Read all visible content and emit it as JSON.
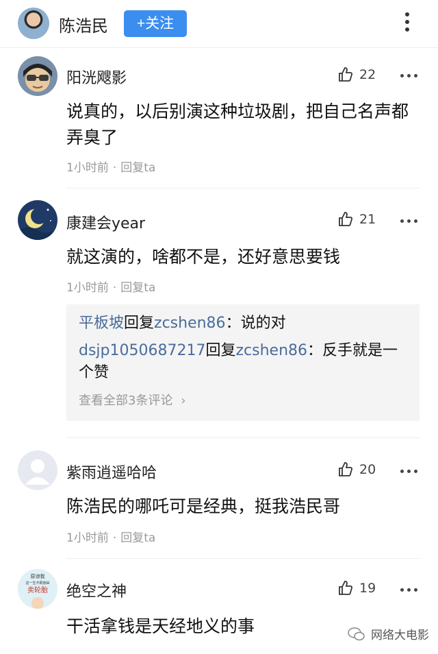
{
  "header": {
    "name": "陈浩民",
    "follow_label": "+关注"
  },
  "comments": [
    {
      "user": "阳洸飕影",
      "likes": "22",
      "text": "说真的，以后别演这种垃圾剧，把自己名声都弄臭了",
      "time": "1小时前",
      "reply": "回复ta"
    },
    {
      "user": "康建会year",
      "likes": "21",
      "text": "就这演的，啥都不是，还好意思要钱",
      "time": "1小时前",
      "reply": "回复ta"
    },
    {
      "user": "紫雨逍遥哈哈",
      "likes": "20",
      "text": "陈浩民的哪吒可是经典，挺我浩民哥",
      "time": "1小时前",
      "reply": "回复ta"
    },
    {
      "user": "绝空之神",
      "likes": "19",
      "text": "干活拿钱是天经地义的事"
    }
  ],
  "replies": {
    "items": [
      {
        "from": "平板坡",
        "verb": "回复",
        "to": "zcshen86",
        "text": "：说的对"
      },
      {
        "from": "dsjp1050687217",
        "verb": "回复",
        "to": "zcshen86",
        "text": "：反手就是一个赞"
      }
    ],
    "view_all": "查看全部3条评论",
    "view_all_chevron": "›"
  },
  "avatar_text": {
    "line1": "原谅我",
    "line2": "这一生不羁放纵",
    "line3": "卖轮胎"
  },
  "watermark": "网络大电影",
  "icons": {
    "like": "thumbs-up-icon",
    "more": "more-horizontal-icon",
    "menu": "more-vertical-icon"
  },
  "colors": {
    "accent": "#3b8ef0",
    "reply_name": "#4a6c9b"
  }
}
